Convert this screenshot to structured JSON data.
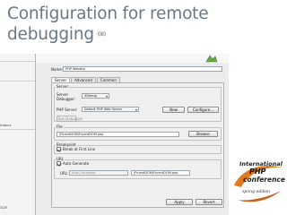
{
  "slide": {
    "title_line1": "Configuration for remote",
    "title_line2": "debugging",
    "title_tag": "(III)"
  },
  "left_panel": {
    "label_1": "htdocs",
    "label_2": "ICXF"
  },
  "dialog": {
    "name_label": "Name:",
    "name_value": "PHP Website",
    "tabs": [
      {
        "label": "Server",
        "active": true
      },
      {
        "label": "Advanced",
        "active": false
      },
      {
        "label": "Common",
        "active": false
      }
    ],
    "server_group": {
      "title": "Server",
      "debugger_label": "Server Debugger:",
      "debugger_value": "XDebug",
      "php_server_label": "PHP Server:",
      "php_server_value": "Default PHP Web Server",
      "new_button": "New",
      "configure_button": "Configure...",
      "test_button": "Test Debugger"
    },
    "file_group": {
      "title": "File",
      "value": "/FruentDOM/FruentDOM.php",
      "browse_button": "Browse"
    },
    "breakpoint_group": {
      "title": "Breakpoint",
      "break_first_line": "Break at First Line",
      "break_first_line_checked": true
    },
    "url_group": {
      "title": "URL",
      "auto_generate": "Auto Generate",
      "auto_generate_checked": true,
      "url_label": "URL:",
      "url_base": "http://localhost",
      "url_path": "/FruentDOM/FruentDOM.php"
    },
    "apply_button": "Apply",
    "revert_button": "Revert"
  },
  "logo": {
    "line1": "International",
    "line2": "PHP",
    "line3": "conference",
    "line4": "spring edition"
  },
  "colors": {
    "title": "#6a7784",
    "dialog_bg": "#ececec",
    "accent_orange": "#e07a1c"
  }
}
